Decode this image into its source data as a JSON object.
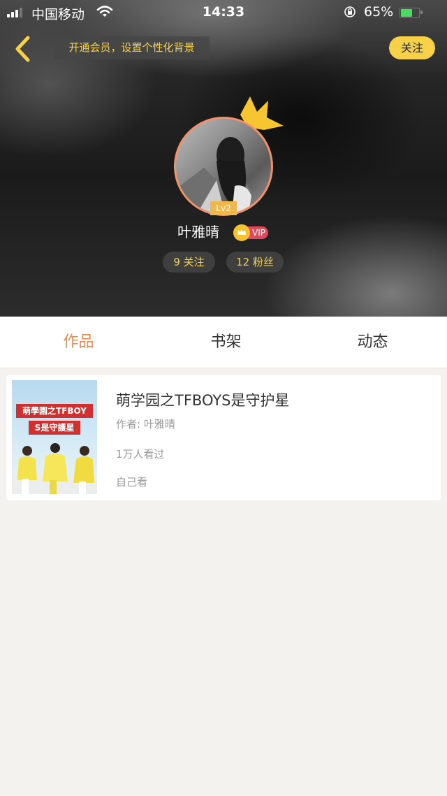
{
  "status_bar": {
    "carrier": "中国移动",
    "time": "14:33",
    "battery_text": "65%",
    "battery_level": 0.65
  },
  "top_bar": {
    "vip_banner": "开通会员，设置个性化背景",
    "follow_label": "关注"
  },
  "profile": {
    "level": "Lv2",
    "username": "叶雅晴",
    "vip_label": "VIP",
    "following": "9 关注",
    "followers": "12 粉丝"
  },
  "tabs": [
    {
      "label": "作品",
      "active": true
    },
    {
      "label": "书架",
      "active": false
    },
    {
      "label": "动态",
      "active": false
    }
  ],
  "works": [
    {
      "cover_line1": "萌學園之TFBOY",
      "cover_line2": "S是守護星",
      "title": "萌学园之TFBOYS是守护星",
      "author": "作者: 叶雅晴",
      "views": "1万人看过",
      "note": "自己看"
    }
  ],
  "colors": {
    "accent_yellow": "#f7d248",
    "tab_active": "#f08a4b",
    "vip_red": "#e0495b",
    "avatar_ring": "#f0916a",
    "page_bg": "#f4f2ee"
  }
}
